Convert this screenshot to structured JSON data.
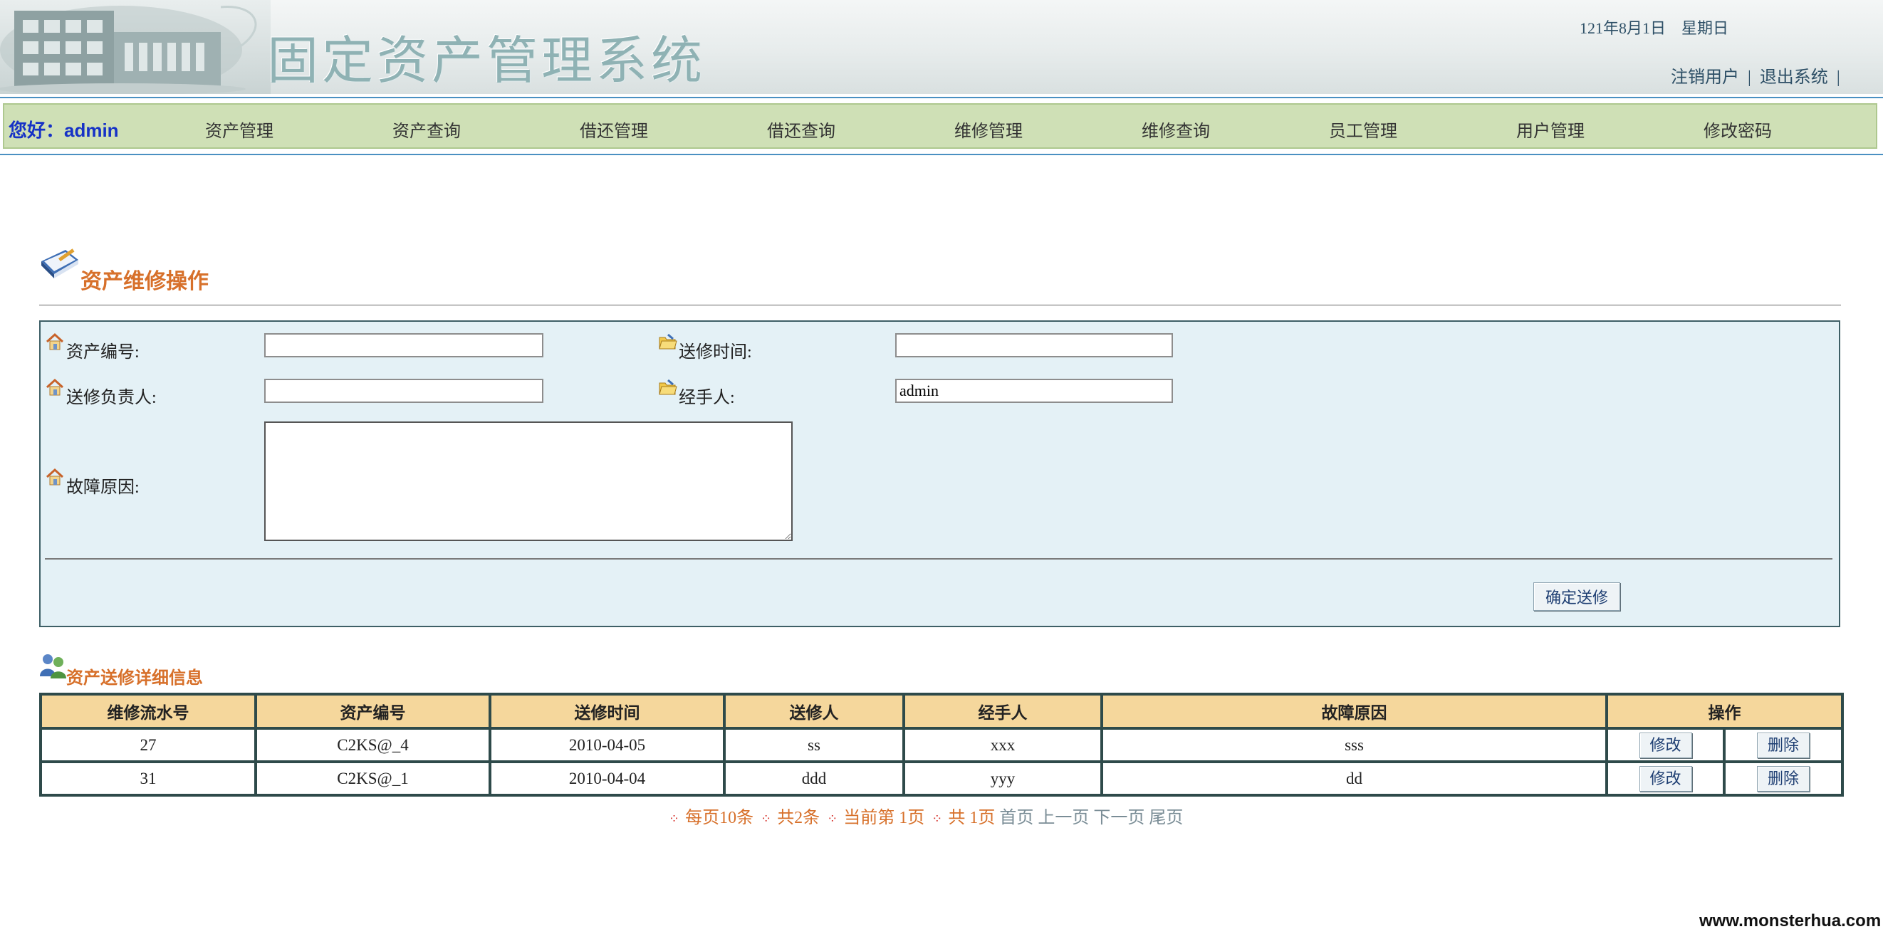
{
  "header": {
    "system_title": "固定资产管理系统",
    "date": "121年8月1日",
    "weekday": "星期日",
    "logout_user": "注销用户",
    "exit_system": "退出系统",
    "separator": "|"
  },
  "nav": {
    "greeting": "您好：admin",
    "items": [
      "资产管理",
      "资产查询",
      "借还管理",
      "借还查询",
      "维修管理",
      "维修查询",
      "员工管理",
      "用户管理",
      "修改密码"
    ]
  },
  "form": {
    "section_title": "资产维修操作",
    "asset_no_label": "资产编号:",
    "asset_no_value": "",
    "send_time_label": "送修时间:",
    "send_time_value": "",
    "responsible_label": "送修负责人:",
    "responsible_value": "",
    "handler_label": "经手人:",
    "handler_value": "admin",
    "reason_label": "故障原因:",
    "reason_value": "",
    "submit_label": "确定送修"
  },
  "detail": {
    "section_title": "资产送修详细信息",
    "columns": [
      "维修流水号",
      "资产编号",
      "送修时间",
      "送修人",
      "经手人",
      "故障原因",
      "操作"
    ],
    "rows": [
      {
        "id": "27",
        "asset_no": "C2KS@_4",
        "send_time": "2010-04-05",
        "sender": "ss",
        "handler": "xxx",
        "reason": "sss",
        "edit": "修改",
        "delete": "删除"
      },
      {
        "id": "31",
        "asset_no": "C2KS@_1",
        "send_time": "2010-04-04",
        "sender": "ddd",
        "handler": "yyy",
        "reason": "dd",
        "edit": "修改",
        "delete": "删除"
      }
    ]
  },
  "pager": {
    "per_page": "每页10条",
    "total": "共2条",
    "current": "当前第 1页",
    "pages": "共 1页",
    "first": "首页",
    "prev": "上一页",
    "next": "下一页",
    "last": "尾页"
  },
  "watermark": "www.monsterhua.com",
  "colors": {
    "nav_bg": "#cfe0b6",
    "greeting": "#1632c6",
    "section_title": "#d7702a",
    "form_bg": "#e4f1f6",
    "table_header": "#f5d79c",
    "table_border": "#2e4a4a"
  }
}
